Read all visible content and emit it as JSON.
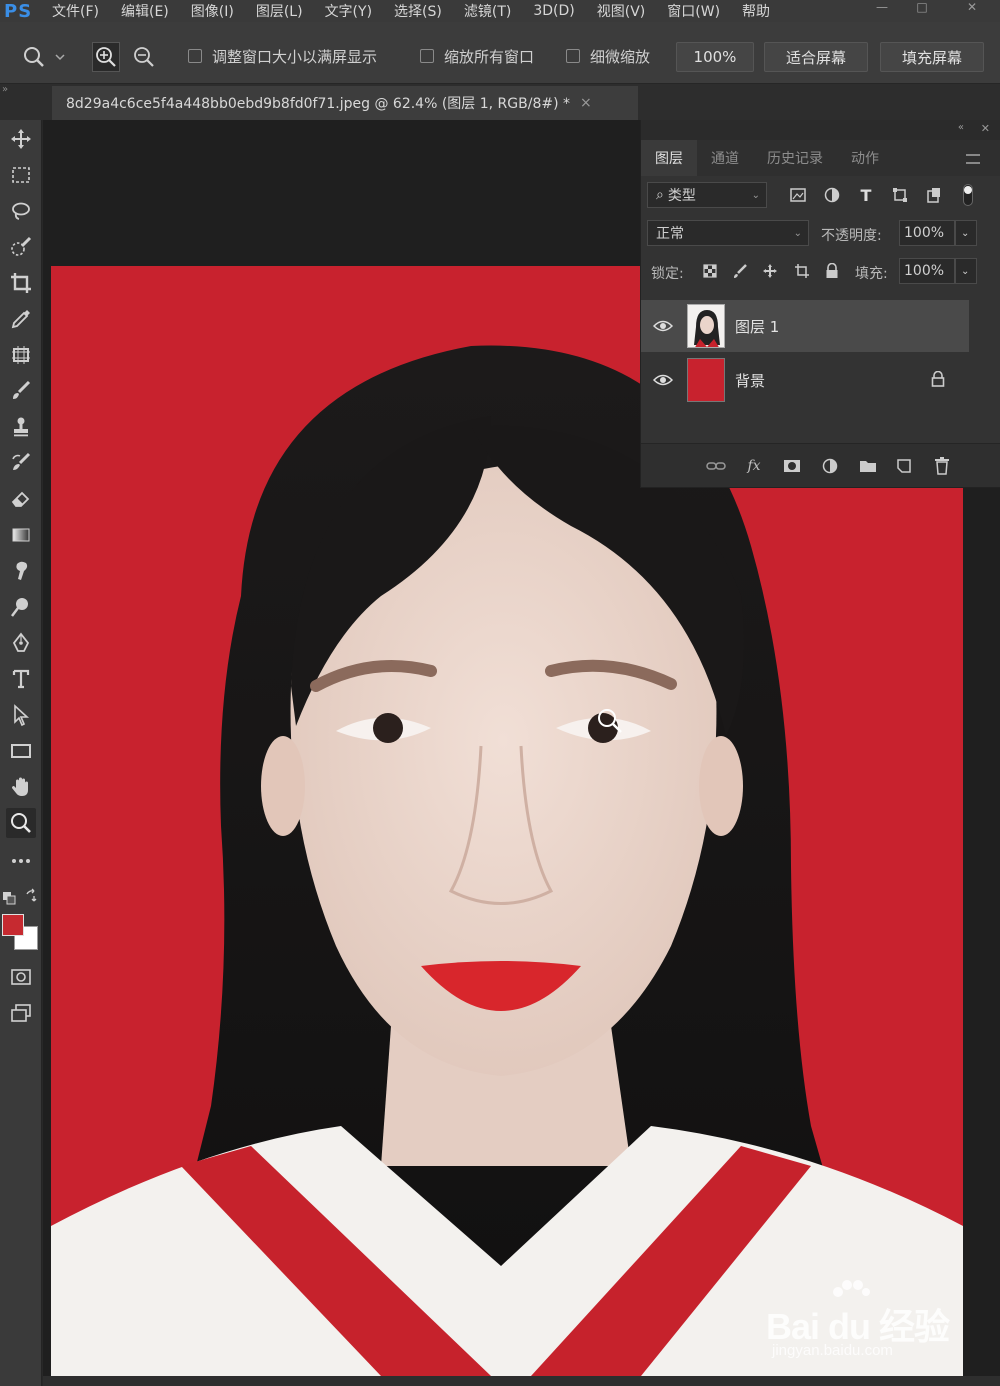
{
  "app": {
    "logo": "PS"
  },
  "menu": [
    "文件(F)",
    "编辑(E)",
    "图像(I)",
    "图层(L)",
    "文字(Y)",
    "选择(S)",
    "滤镜(T)",
    "3D(D)",
    "视图(V)",
    "窗口(W)",
    "帮助"
  ],
  "options": {
    "fit_window_label": "调整窗口大小以满屏显示",
    "zoom_all_label": "缩放所有窗口",
    "scrubby_label": "细微缩放",
    "zoom_value": "100%",
    "fit_screen_label": "适合屏幕",
    "fill_screen_label": "填充屏幕"
  },
  "document": {
    "tab_title": "8d29a4c6ce5f4a448bb0ebd9b8fd0f71.jpeg @ 62.4% (图层 1, RGB/8#) *",
    "close_glyph": "×"
  },
  "tools": [
    "move-icon",
    "marquee-icon",
    "lasso-icon",
    "quick-select-icon",
    "crop-icon",
    "eyedropper-icon",
    "frame-icon",
    "brush-icon",
    "stamp-icon",
    "history-brush-icon",
    "eraser-icon",
    "gradient-icon",
    "smudge-icon",
    "dodge-icon",
    "pen-icon",
    "type-icon",
    "path-select-icon",
    "rectangle-icon",
    "hand-icon",
    "zoom-icon",
    "more-icon"
  ],
  "colors": {
    "foreground": "#c62a30",
    "background": "#ffffff",
    "photo_bg": "#c8222e"
  },
  "layers_panel": {
    "tabs": [
      "图层",
      "通道",
      "历史记录",
      "动作"
    ],
    "active_tab": "图层",
    "filter_kind": "类型",
    "blend_mode": "正常",
    "opacity_label": "不透明度:",
    "opacity_value": "100%",
    "lock_label": "锁定:",
    "fill_label": "填充:",
    "fill_value": "100%",
    "layers": [
      {
        "name": "图层 1",
        "visible": true,
        "selected": true,
        "locked": false
      },
      {
        "name": "背景",
        "visible": true,
        "selected": false,
        "locked": true
      }
    ],
    "footer_icons": [
      "link-icon",
      "fx-icon",
      "mask-icon",
      "adjustment-icon",
      "group-folder-icon",
      "new-layer-icon",
      "trash-icon"
    ]
  },
  "watermark": {
    "brand": "Bai du 经验",
    "url": "jingyan.baidu.com"
  }
}
